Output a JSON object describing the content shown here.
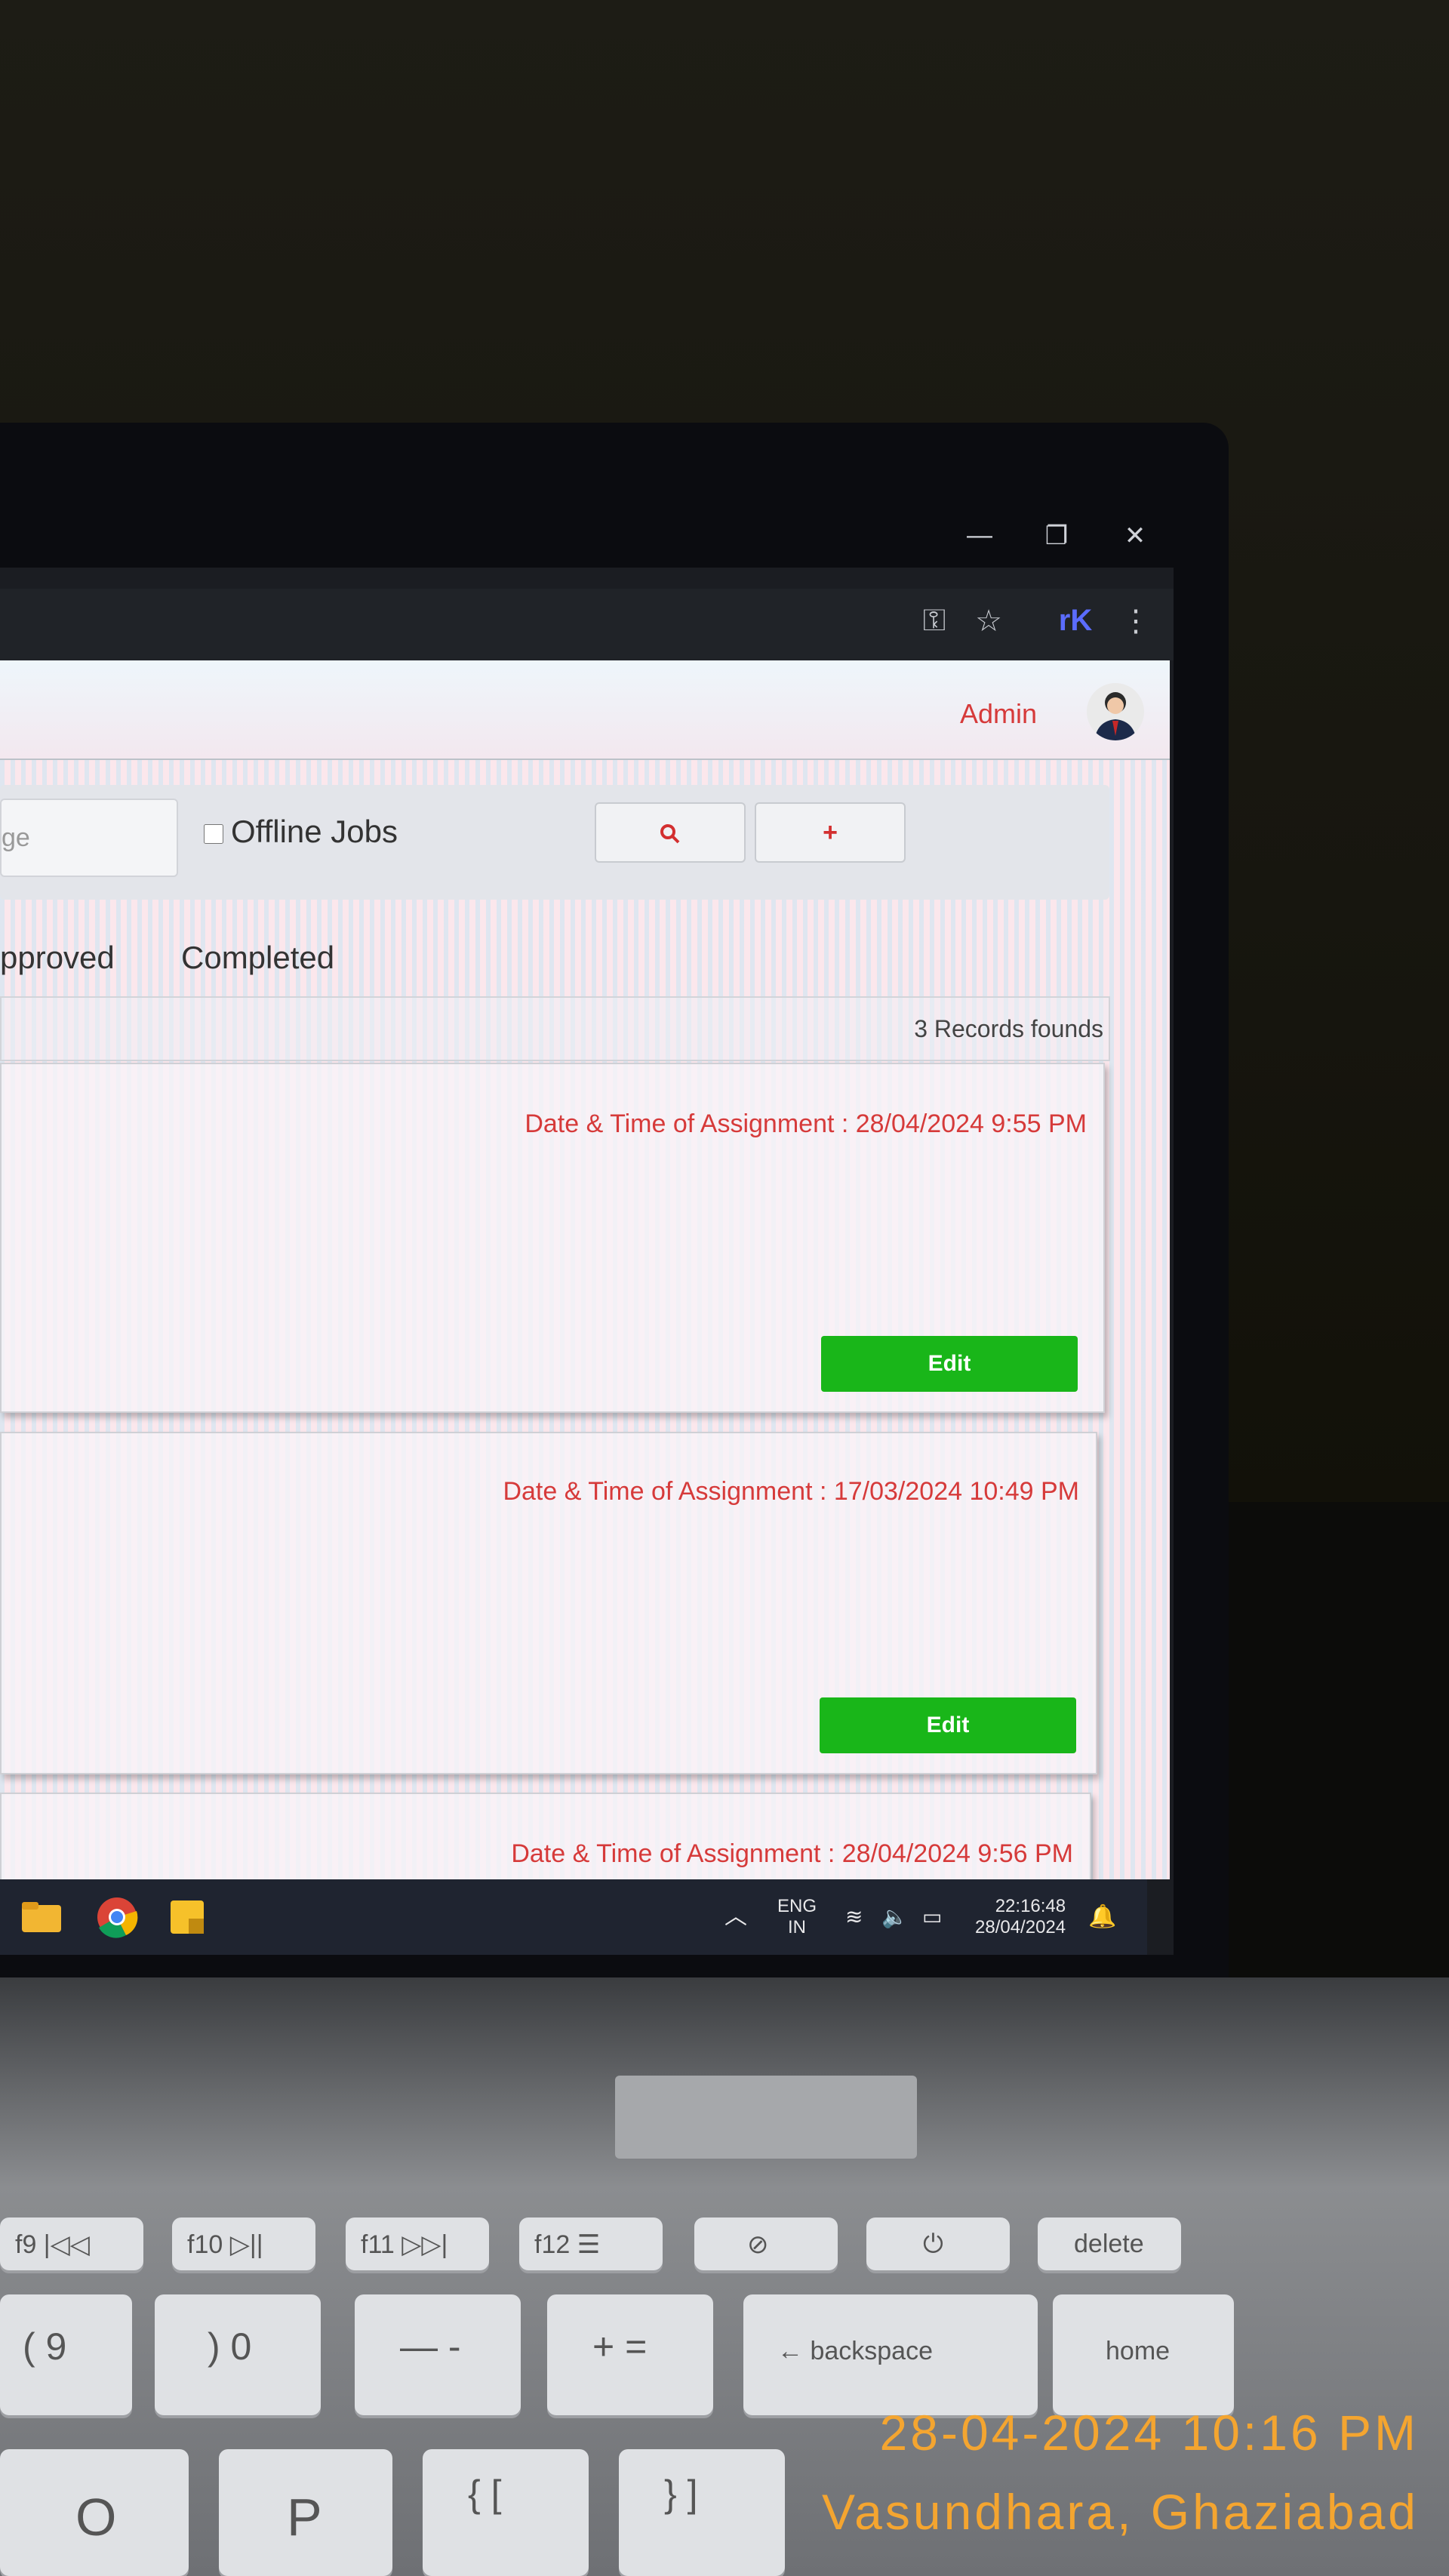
{
  "window_controls": {
    "minimize": "—",
    "restore": "❐",
    "close": "✕"
  },
  "toolbar_icons": [
    "key-icon",
    "star-icon",
    "extension-icon",
    "menu-icon"
  ],
  "header": {
    "admin_label": "Admin"
  },
  "filters": {
    "search_value": "ge",
    "offline_label": "Offline Jobs",
    "search_button_icon": "search-icon",
    "add_button_label": "+"
  },
  "tabs": [
    {
      "label": "pproved"
    },
    {
      "label": "Completed"
    }
  ],
  "records_count": "3 Records founds",
  "jobs": [
    {
      "date_label": "Date & Time of Assignment : 28/04/2024 9:55 PM",
      "edit_label": "Edit"
    },
    {
      "date_label": "Date & Time of Assignment : 17/03/2024 10:49 PM",
      "edit_label": "Edit"
    },
    {
      "date_label": "Date & Time of Assignment : 28/04/2024 9:56 PM"
    }
  ],
  "taskbar": {
    "lang_line1": "ENG",
    "lang_line2": "IN",
    "time": "22:16:48",
    "date": "28/04/2024",
    "apps": [
      "folder-icon",
      "chrome-icon",
      "sticky-notes-icon"
    ]
  },
  "keyboard": {
    "fn_keys": [
      "f9 |◁◁",
      "f10 ▷||",
      "f11 ▷▷|",
      "f12 ☰",
      "⊘",
      "⏻",
      "delete"
    ],
    "row2": [
      "( 9",
      ") 0",
      "— -",
      "+ =",
      "← backspace",
      "home"
    ],
    "row3": [
      "O",
      "P",
      "{ [",
      "} ]"
    ]
  },
  "photo_stamp": {
    "datetime": "28-04-2024 10:16 PM",
    "location": "Vasundhara, Ghaziabad"
  },
  "colors": {
    "accent_red": "#d63a3a",
    "edit_green": "#19b619",
    "stamp": "#f4a530"
  }
}
